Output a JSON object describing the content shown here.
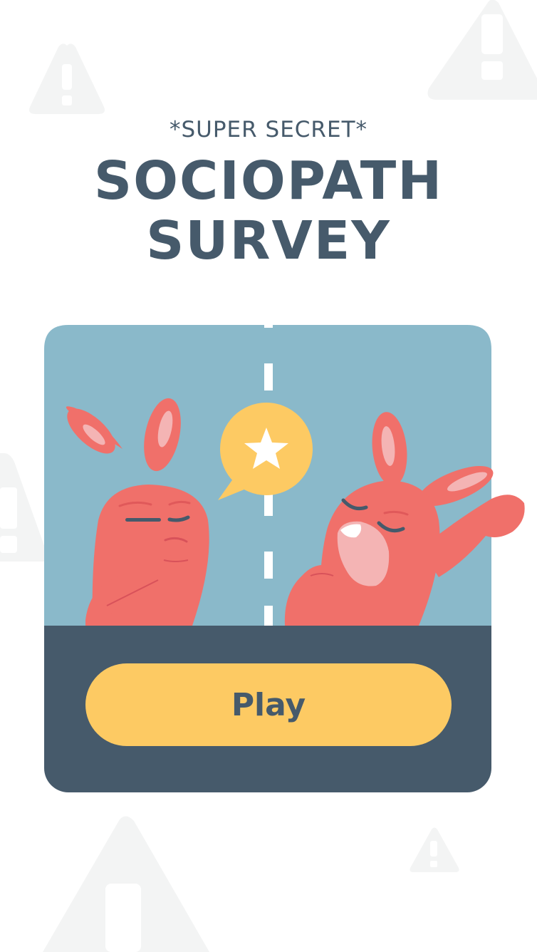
{
  "header": {
    "subtitle": "*SUPER SECRET*",
    "title_line_1": "SOCIOPATH",
    "title_line_2": "SURVEY"
  },
  "play_button": {
    "label": "Play"
  },
  "colors": {
    "background": "#ffffff",
    "text_dark": "#465a6b",
    "card_sky": "#8ab9ca",
    "card_ground": "#465a6b",
    "button_yellow": "#fdca63",
    "character_coral": "#f0706a",
    "ear_inner_pink": "#f4b4b4",
    "warning_icon_grey": "#f3f4f4"
  },
  "illustration": {
    "characters": [
      "bunny-thinking",
      "bunny-yelling"
    ],
    "speech_bubble_icon": "star-icon"
  }
}
